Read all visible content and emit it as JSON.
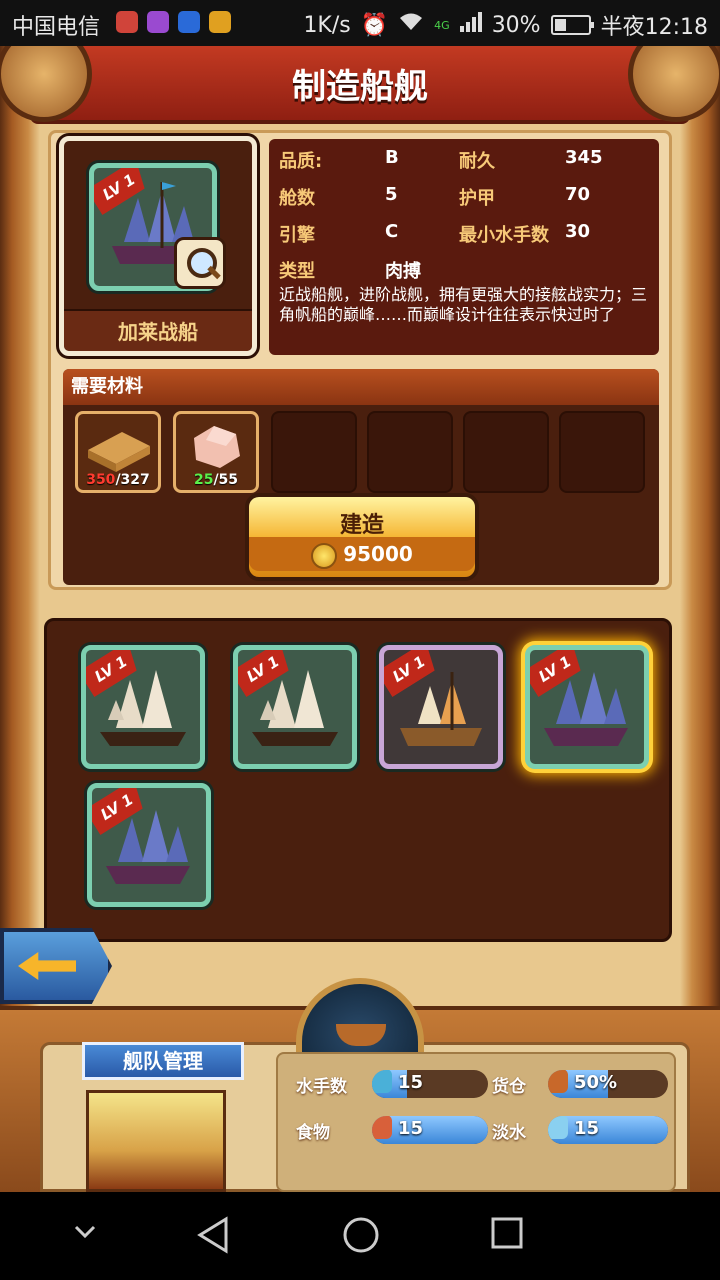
{
  "status_bar": {
    "carrier": "中国电信",
    "net_speed": "1K/s",
    "network_type": "4G",
    "battery": "30%",
    "time": "半夜12:18"
  },
  "screen_title": "制造船舰",
  "ship_detail": {
    "level_tag": "LV 1",
    "name": "加莱战船",
    "stats": [
      {
        "label": "品质:",
        "value": "B"
      },
      {
        "label": "耐久",
        "value": "345"
      },
      {
        "label": "舱数",
        "value": "5"
      },
      {
        "label": "护甲",
        "value": "70"
      },
      {
        "label": "引擎",
        "value": "C"
      },
      {
        "label": "最小水手数",
        "value": "30"
      },
      {
        "label": "类型",
        "value": "肉搏"
      }
    ],
    "description": "近战船舰，进阶战舰，拥有更强大的接舷战实力；三角帆船的巅峰……而巅峰设计往往表示快过时了"
  },
  "materials": {
    "header": "需要材料",
    "items": [
      {
        "name": "wood-icon",
        "have": "350",
        "need": "/327",
        "have_color": "#ff3b2f"
      },
      {
        "name": "stone-icon",
        "have": "25",
        "need": "/55",
        "have_color": "#5bf04a"
      }
    ]
  },
  "build_button": {
    "label": "建造",
    "cost": "95000"
  },
  "ship_list": [
    {
      "level": "LV 1",
      "type": "frigate"
    },
    {
      "level": "LV 1",
      "type": "frigate"
    },
    {
      "level": "LV 1",
      "type": "caravel"
    },
    {
      "level": "LV 1",
      "type": "galleon",
      "selected": true
    },
    {
      "level": "LV 1",
      "type": "galleon"
    }
  ],
  "fleet": {
    "title": "舰队管理",
    "stats": {
      "sailors_label": "水手数",
      "sailors_value": "15",
      "cargo_label": "货仓",
      "cargo_value": "50%",
      "food_label": "食物",
      "food_value": "15",
      "water_label": "淡水",
      "water_value": "15"
    }
  },
  "colors": {
    "accent_red": "#c33a22",
    "panel_brown": "#4a1f0e",
    "selected_glow": "#ffd23a",
    "stat_blue": "#3a86d8"
  }
}
